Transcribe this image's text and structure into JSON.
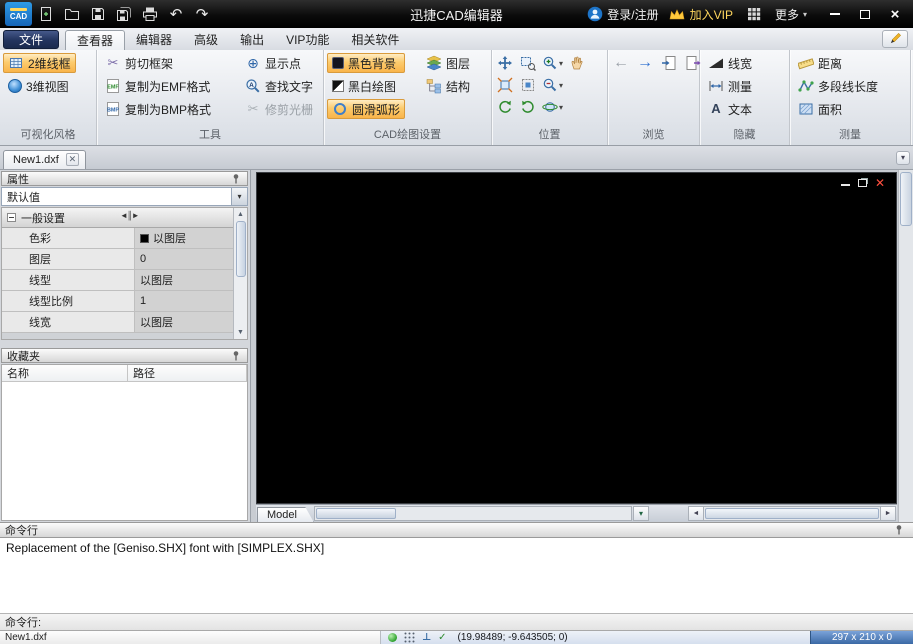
{
  "titlebar": {
    "logo_text": "CAD",
    "title": "迅捷CAD编辑器",
    "login_label": "登录/注册",
    "vip_label": "加入VIP",
    "more_label": "更多"
  },
  "menubar": {
    "file_label": "文件",
    "tabs": [
      "查看器",
      "编辑器",
      "高级",
      "输出",
      "VIP功能",
      "相关软件"
    ]
  },
  "ribbon": {
    "visual_group": {
      "label": "可视化风格",
      "wireframe_2d": "2维线框",
      "view_3d": "3维视图"
    },
    "tools_group": {
      "label": "工具",
      "clip_frame": "剪切框架",
      "copy_emf": "复制为EMF格式",
      "copy_bmp": "复制为BMP格式",
      "show_points": "显示点",
      "find_text": "查找文字",
      "trim_raster": "修剪光栅"
    },
    "draw_settings_group": {
      "label": "CAD绘图设置",
      "black_background": "黑色背景",
      "bw_drawing": "黑白绘图",
      "smooth_arc": "圆滑弧形",
      "layers": "图层",
      "structure": "结构"
    },
    "position_group": {
      "label": "位置"
    },
    "browse_group": {
      "label": "浏览"
    },
    "hide_group": {
      "label": "隐藏",
      "line_width": "线宽",
      "measure": "测量",
      "text": "文本"
    },
    "measure_group": {
      "label": "测量",
      "distance": "距离",
      "polyline_length": "多段线长度",
      "area": "面积"
    }
  },
  "document_tabs": {
    "active_tab": "New1.dxf"
  },
  "properties_panel": {
    "title": "属性",
    "selector_value": "默认值",
    "group_header": "一般设置",
    "rows": [
      {
        "label": "色彩",
        "value": "以图层",
        "swatch": "#000000"
      },
      {
        "label": "图层",
        "value": "0"
      },
      {
        "label": "线型",
        "value": "以图层"
      },
      {
        "label": "线型比例",
        "value": "1"
      },
      {
        "label": "线宽",
        "value": "以图层"
      }
    ]
  },
  "favorites_panel": {
    "title": "收藏夹",
    "col_name": "名称",
    "col_path": "路径"
  },
  "canvas": {
    "model_tab": "Model"
  },
  "command_panel": {
    "title": "命令行",
    "message": "Replacement of the [Geniso.SHX] font with [SIMPLEX.SHX]",
    "prompt": "命令行:"
  },
  "statusbar": {
    "file_name": "New1.dxf",
    "coordinates": "(19.98489; -9.643505; 0)",
    "dimensions": "297 x 210 x 0"
  },
  "colors": {
    "toggle_orange": "#fbb44a",
    "vip_gold": "#ffd75e",
    "logo_blue": "#1a7ad4",
    "status_blue": "#3b69a5",
    "canvas_black": "#000000"
  }
}
